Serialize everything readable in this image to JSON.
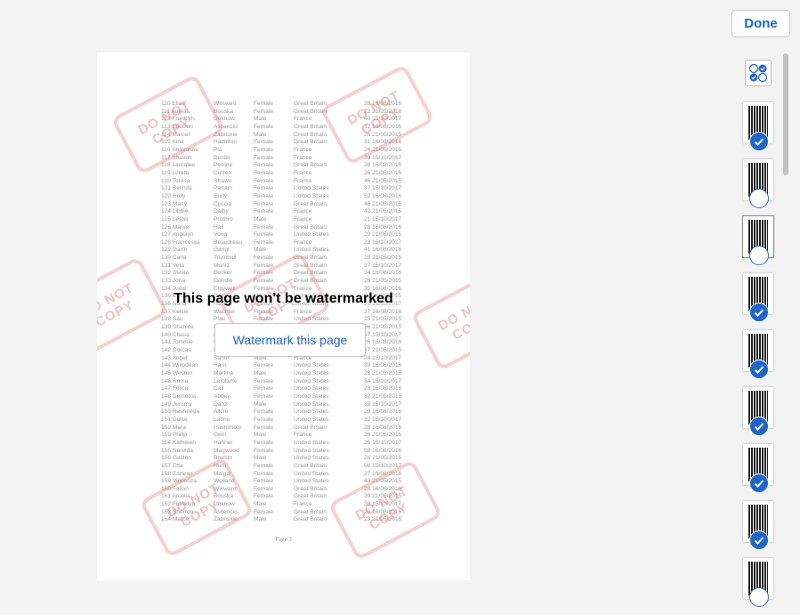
{
  "done_label": "Done",
  "overlay_title": "This page won't be watermarked",
  "watermark_button": "Watermark this page",
  "page_footer": "Page 3",
  "stamp_text": [
    "DO NOT",
    "COPY"
  ],
  "accent_color": "#1f66c9",
  "stamp_color": "#e27878",
  "rows": [
    [
      "110 Elias",
      "Winward",
      "Female",
      "Great Britain",
      "28 16/08/2016"
    ],
    [
      "111 Aurelia",
      "Bouska",
      "Female",
      "Great Britain",
      "22 21/05/2016"
    ],
    [
      "112 Franklyn",
      "Unknow",
      "Male",
      "France",
      "40 15/10/2017"
    ],
    [
      "113 Sherron",
      "Ascencio",
      "Female",
      "Great Britain",
      "32 16/08/2016"
    ],
    [
      "114 Marcel",
      "Zabriskie",
      "Male",
      "Great Britain",
      "26 21/05/2015"
    ],
    [
      "115 Kina",
      "Hazelton",
      "Female",
      "Great Britain",
      "31 16/08/2016"
    ],
    [
      "116 Shavonne",
      "Pia",
      "Female",
      "France",
      "24 21/05/2015"
    ],
    [
      "117 Shavon",
      "Benito",
      "Female",
      "France",
      "39 15/10/2017"
    ],
    [
      "118 Lauralee",
      "Perrine",
      "Female",
      "Great Britain",
      "28 16/08/2015"
    ],
    [
      "119 Loreta",
      "Curren",
      "Female",
      "France",
      "26 21/05/2015"
    ],
    [
      "120 Teresa",
      "Strawn",
      "Female",
      "France",
      "46 21/05/2015"
    ],
    [
      "121 Belinda",
      "Partain",
      "Female",
      "United States",
      "37 15/10/2017"
    ],
    [
      "122 Holly",
      "Eudy",
      "Female",
      "United States",
      "52 16/08/2016"
    ],
    [
      "123 Many",
      "Cuccia",
      "Female",
      "Great Britain",
      "46 21/05/2015"
    ],
    [
      "124 Libbie",
      "Dalby",
      "Female",
      "France",
      "42 21/05/2015"
    ],
    [
      "125 Lester",
      "Prothro",
      "Male",
      "France",
      "21 15/10/2017"
    ],
    [
      "126 Marvel",
      "Hail",
      "Female",
      "Great Britain",
      "28 16/08/2016"
    ],
    [
      "127 Angelyn",
      "Vong",
      "Female",
      "United States",
      "29 21/05/2015"
    ],
    [
      "128 Francesca",
      "Beaudreau",
      "Female",
      "France",
      "23 15/10/2017"
    ],
    [
      "129 Garth",
      "Gangi",
      "Male",
      "United States",
      "41 16/08/2016"
    ],
    [
      "130 Carla",
      "Trumbull",
      "Female",
      "Great Britain",
      "28 21/05/2015"
    ],
    [
      "131 Veta",
      "Muntz",
      "Female",
      "Great Britain",
      "37 15/10/2017"
    ],
    [
      "132 Stasia",
      "Becker",
      "Female",
      "Great Britain",
      "34 16/08/2016"
    ],
    [
      "133 Jona",
      "Grindle",
      "Female",
      "Great Britain",
      "26 21/05/2015"
    ],
    [
      "134 Judie",
      "Claywell",
      "Female",
      "France",
      "35 16/08/2016"
    ],
    [
      "135 Dewitt",
      "Borger",
      "Male",
      "United States",
      "36 21/05/2015"
    ],
    [
      "136 Nena",
      "Hacker",
      "Female",
      "United States",
      "29 15/10/2017"
    ],
    [
      "137 Kelsie",
      "Wachtel",
      "Female",
      "France",
      "27 16/08/2016"
    ],
    [
      "138 Sau",
      "Pfau",
      "Female",
      "United States",
      "25 21/05/2015"
    ],
    [
      "139 Shanice",
      "Mccrystal",
      "Female",
      "United States",
      "36 21/05/2015"
    ],
    [
      "140 Chase",
      "Karner",
      "Male",
      "United States",
      "37 15/10/2017"
    ],
    [
      "141 Tommie",
      "Underdahl",
      "Male",
      "United States",
      "26 16/08/2016"
    ],
    [
      "142 Dorcas",
      "Darity",
      "Female",
      "United States",
      "37 21/05/2015"
    ],
    [
      "143 Angel",
      "Sanor",
      "Male",
      "France",
      "24 15/10/2017"
    ],
    [
      "144 Willodean",
      "Harn",
      "Female",
      "United States",
      "39 16/08/2016"
    ],
    [
      "145 Weston",
      "Martina",
      "Male",
      "United States",
      "26 21/05/2015"
    ],
    [
      "146 Roma",
      "Lafollette",
      "Female",
      "United States",
      "34 15/10/2017"
    ],
    [
      "147 Felisa",
      "Cail",
      "Female",
      "United States",
      "28 16/08/2016"
    ],
    [
      "148 Demetria",
      "Abbey",
      "Female",
      "United States",
      "32 21/05/2015"
    ],
    [
      "149 Jeromy",
      "Danz",
      "Male",
      "United States",
      "39 15/10/2017"
    ],
    [
      "150 Rasheeda",
      "Alkire",
      "Female",
      "United States",
      "29 16/08/2016"
    ],
    [
      "151 Dulce",
      "Labrie",
      "Female",
      "United States",
      "32 15/10/2017"
    ],
    [
      "152 Mara",
      "Hashimoto",
      "Female",
      "Great Britain",
      "28 16/08/2016"
    ],
    [
      "153 Philip",
      "Gent",
      "Male",
      "France",
      "36 21/05/2015"
    ],
    [
      "154 Kathleen",
      "Hanner",
      "Female",
      "United States",
      "25 15/10/2017"
    ],
    [
      "155 Nereida",
      "Magwood",
      "Female",
      "United States",
      "58 16/08/2016"
    ],
    [
      "156 Gaston",
      "Brumm",
      "Male",
      "United States",
      "24 21/05/2015"
    ],
    [
      "157 Etta",
      "Hurn",
      "Female",
      "Great Britain",
      "56 15/10/2017"
    ],
    [
      "158 Earlean",
      "Melgar",
      "Female",
      "United States",
      "27 16/08/2016"
    ],
    [
      "159 Vincenza",
      "Weiland",
      "Female",
      "United States",
      "40 21/05/2015"
    ],
    [
      "160 Fallon",
      "Winward",
      "Female",
      "Great Britain",
      "28 16/08/2016"
    ],
    [
      "161 Arcelia",
      "Bouska",
      "Female",
      "Great Britain",
      "39 21/05/2015"
    ],
    [
      "162 Franklyn",
      "Unknow",
      "Male",
      "France",
      "38 15/10/2017"
    ],
    [
      "163 Sherron",
      "Ascencio",
      "Female",
      "Great Britain",
      "28 16/08/2016"
    ],
    [
      "164 Marcel",
      "Zabriskie",
      "Male",
      "Great Britain",
      "23 21/05/2015"
    ]
  ],
  "thumbnails": [
    {
      "selected": true
    },
    {
      "selected": false
    },
    {
      "selected": false,
      "current": true
    },
    {
      "selected": true
    },
    {
      "selected": true
    },
    {
      "selected": true
    },
    {
      "selected": true
    },
    {
      "selected": true
    },
    {
      "selected": false
    }
  ]
}
